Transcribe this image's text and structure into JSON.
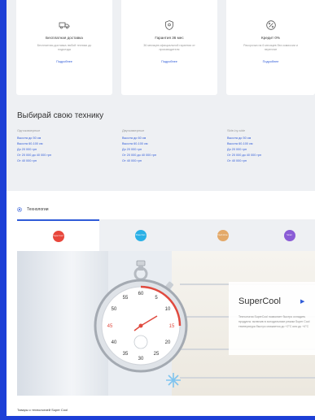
{
  "features": [
    {
      "title": "Бесплатная доставка",
      "desc": "Бесплатная доставка любой техники до подъезда",
      "link": "Подробнее"
    },
    {
      "title": "Гарантия 36 мес",
      "desc": "36 месяцев официальной гарантии от производителя",
      "link": "Подробнее"
    },
    {
      "title": "Кредит 0%",
      "desc": "Рассрочка на 6 месяцев без комиссии и переплат",
      "link": "Подробнее"
    }
  ],
  "choose": {
    "title": "Выбирай свою технику",
    "columns": [
      {
        "head": "Однокамерные",
        "items": [
          "Высота до 50 см",
          "Высота 60-100 см",
          "До 20 000 грн",
          "От 20 000 до 40 000 грн",
          "От 40 000 грн"
        ]
      },
      {
        "head": "Двухкамерные",
        "items": [
          "Высота до 60 см",
          "Высота 60-100 см",
          "До 20 000 грн",
          "От 20 000 до 40 000 грн",
          "От 40 000 грн"
        ]
      },
      {
        "head": "Side-by-side",
        "items": [
          "Высота до 50 см",
          "Высота 60-100 см",
          "До 20 000 грн",
          "От 20 000 до 40 000 грн",
          "От 40 000 грн"
        ]
      }
    ]
  },
  "tech": {
    "title": "Технологии",
    "tabs": [
      {
        "label": "Super Cool",
        "color": "#e8473c"
      },
      {
        "label": "Power Fan",
        "color": "#2ab0e6"
      },
      {
        "label": "Fresh Zone",
        "color": "#e3a969"
      },
      {
        "label": "Smart",
        "color": "#8a5cd6"
      }
    ],
    "banner_title": "SuperCool",
    "banner_arrow": "▶",
    "banner_desc": "Технология SuperCool позволяет быстро охладить продукты: включив в холодильнике режим Super Cool температура быстро снижается до +2°С или до +4°С",
    "dial_numbers": [
      "60",
      "5",
      "10",
      "15",
      "20",
      "25",
      "30",
      "35",
      "40",
      "45",
      "50",
      "55"
    ]
  },
  "footer": {
    "text": "Товары с технологией Super Cool"
  }
}
